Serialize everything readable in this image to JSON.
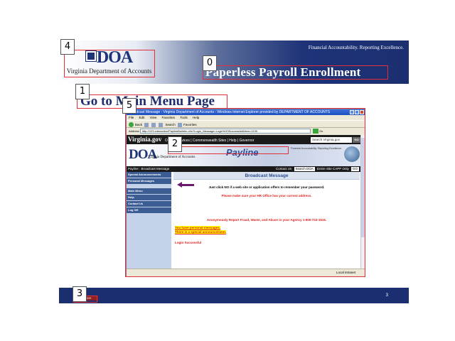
{
  "slide": {
    "org_name": "Virginia Department of Accounts",
    "org_logo_text": "DOA",
    "tagline": "Financial Accountability. Reporting Excellence.",
    "title": "Paperless Payroll Enrollment",
    "heading": "Go to Main Menu Page",
    "page_number": "3",
    "footer_badge": "VA DOA 2020"
  },
  "annotations": [
    "0",
    "1",
    "2",
    "3",
    "4",
    "5"
  ],
  "browser": {
    "window_title": "Broadcast Message - Virginia Department of Accounts - Windows Internet Explorer provided by DEPARTMENT OF ACCOUNTS",
    "menu": [
      "File",
      "Edit",
      "View",
      "Favorites",
      "Tools",
      "Help"
    ],
    "toolbar": {
      "back": "Back",
      "search": "Search",
      "favorites": "Favorites"
    },
    "address_label": "Address",
    "address": "http://123.interaction/PaylineBulletin.cfm?Login_Message=Login%20Successful&item=1130",
    "go_label": "Go",
    "status_zone": "Local intranet"
  },
  "webpage": {
    "vg_logo": "Virginia.gov",
    "vg_links": "Online Services | Commonwealth Sites | Help | Governor",
    "vg_search": "Search Virginia.gov",
    "go": "GO",
    "payline_logo": "DOA",
    "payline_sub": "Virginia Department of Accounts",
    "payline_name": "Payline",
    "payline_tag": "Financial Accountability. Reporting Excellence.",
    "nav_left": "Payline : Broadcast Message",
    "nav_contact": "Contact Us",
    "nav_search": "Search DOA",
    "nav_opts": "Entire Site  CAPP Only",
    "sidebar": [
      "Special Announcements",
      "Personal Messages",
      "Main Menu",
      "Help",
      "Contact Us",
      "Log Off"
    ],
    "content_title": "Broadcast Message",
    "msg_line1": "Just click NO if a web site or application offers to remember your password.",
    "msg_line2": "Please make sure your HR Office has your current address.",
    "msg_line3": "Anonymously Report Fraud, Waste, and Abuse in your Agency 1-800-723-1615.",
    "personal_msg": "You have personal messages.",
    "special_msg": "There is a special announcement.",
    "login_status": "Login Successful"
  }
}
